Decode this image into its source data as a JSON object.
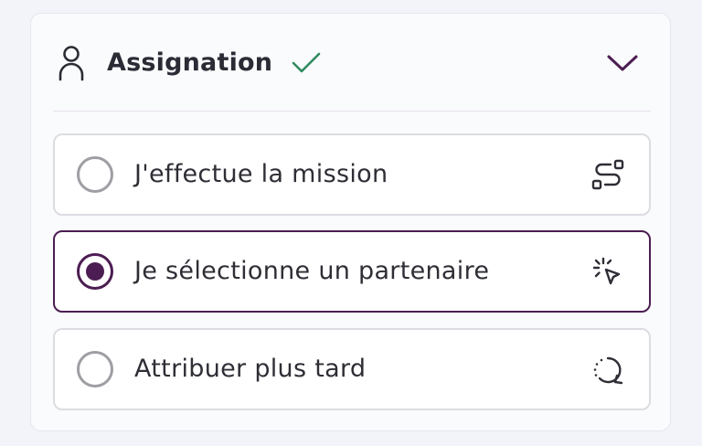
{
  "section": {
    "title": "Assignation",
    "title_icon": "user-icon",
    "status_icon": "check-icon",
    "toggle_icon": "chevron-down-icon"
  },
  "options": [
    {
      "label": "J'effectue la mission",
      "selected": false,
      "icon": "route-icon"
    },
    {
      "label": "Je sélectionne un partenaire",
      "selected": true,
      "icon": "pointer-click-icon"
    },
    {
      "label": "Attribuer plus tard",
      "selected": false,
      "icon": "rotate-clock-icon"
    }
  ],
  "colors": {
    "accent": "#4c1d52",
    "check": "#2f8a5e",
    "text": "#2e2e36",
    "border": "#dcdde2"
  }
}
